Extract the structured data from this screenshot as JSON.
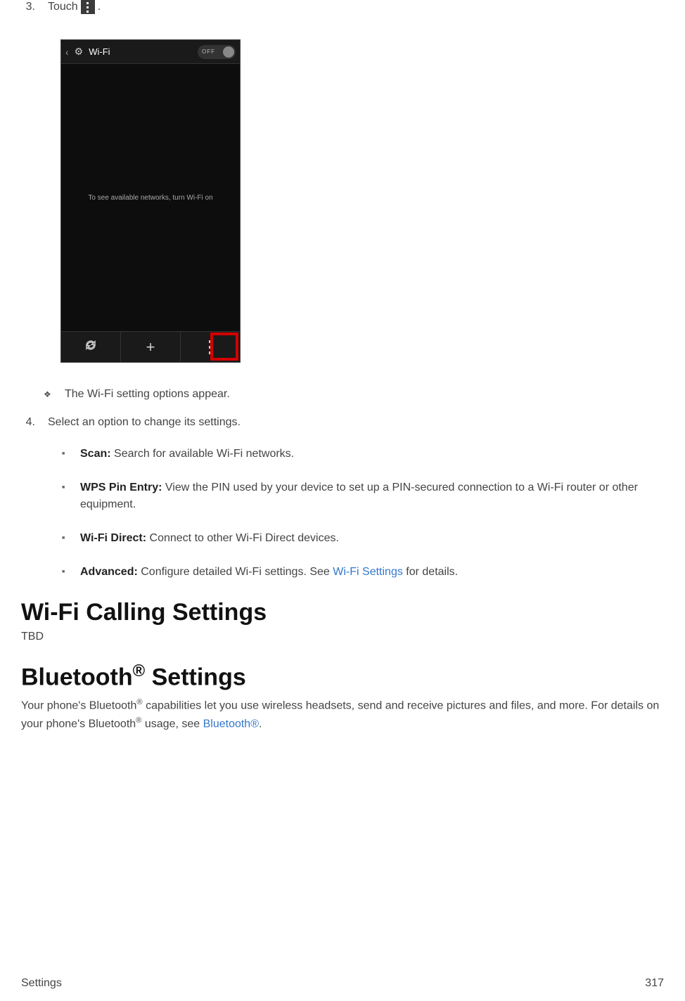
{
  "step3": {
    "number": "3.",
    "prefix": "Touch ",
    "suffix": "."
  },
  "phone": {
    "title": "Wi-Fi",
    "toggle": "OFF",
    "body_text": "To see available networks, turn Wi-Fi on"
  },
  "result": {
    "text": "The Wi-Fi setting options appear."
  },
  "step4": {
    "number": "4.",
    "text": "Select an option to change its settings."
  },
  "options": {
    "scan": {
      "label": "Scan:",
      "desc": " Search for available Wi-Fi networks."
    },
    "wps": {
      "label": "WPS Pin Entry:",
      "desc": " View the PIN used by your device to set up a PIN-secured connection to a Wi-Fi router or other equipment."
    },
    "direct": {
      "label": "Wi-Fi Direct:",
      "desc": " Connect to other Wi-Fi Direct devices."
    },
    "advanced": {
      "label": "Advanced:",
      "desc_before": " Configure detailed Wi-Fi settings. See ",
      "link": "Wi-Fi Settings",
      "desc_after": " for details."
    }
  },
  "heading_wifi_calling": "Wi-Fi Calling Settings",
  "tbd": "TBD",
  "heading_bluetooth_prefix": "Bluetooth",
  "heading_bluetooth_suffix": " Settings",
  "bluetooth_para": {
    "p1": "Your phone's Bluetooth",
    "p2": " capabilities let you use wireless headsets, send and receive pictures and files, and more. For details on your phone's Bluetooth",
    "p3": " usage, see ",
    "link": "Bluetooth®",
    "p4": "."
  },
  "footer": {
    "left": "Settings",
    "right": "317"
  },
  "reg": "®"
}
